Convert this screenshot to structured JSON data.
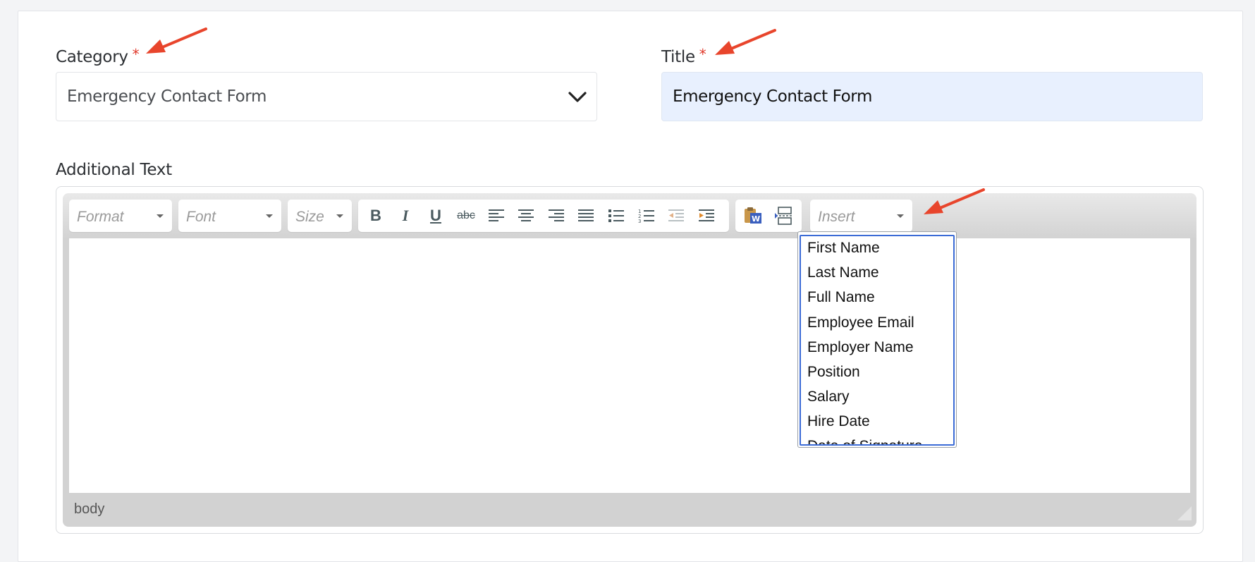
{
  "category": {
    "label": "Category",
    "required_mark": "*",
    "selected_value": "Emergency Contact Form"
  },
  "title": {
    "label": "Title",
    "required_mark": "*",
    "value": "Emergency Contact Form"
  },
  "additional_text": {
    "label": "Additional Text",
    "toolbar": {
      "format_placeholder": "Format",
      "font_placeholder": "Font",
      "size_placeholder": "Size",
      "insert_placeholder": "Insert",
      "buttons": [
        {
          "icon": "bold-icon",
          "glyph": "B"
        },
        {
          "icon": "italic-icon",
          "glyph": "I"
        },
        {
          "icon": "underline-icon",
          "glyph": "U"
        },
        {
          "icon": "strikethrough-icon",
          "glyph": "abc"
        },
        {
          "icon": "align-left-icon"
        },
        {
          "icon": "align-center-icon"
        },
        {
          "icon": "align-right-icon"
        },
        {
          "icon": "align-justify-icon"
        },
        {
          "icon": "bulleted-list-icon"
        },
        {
          "icon": "numbered-list-icon"
        },
        {
          "icon": "outdent-icon"
        },
        {
          "icon": "indent-icon"
        },
        {
          "icon": "paste-from-word-icon"
        },
        {
          "icon": "page-break-icon"
        }
      ]
    },
    "insert_options": [
      "First Name",
      "Last Name",
      "Full Name",
      "Employee Email",
      "Employer Name",
      "Position",
      "Salary",
      "Hire Date",
      "Date of Signature"
    ],
    "status_path": "body"
  },
  "colors": {
    "required": "#e0392b",
    "annotation_arrow": "#e8452c",
    "title_fill": "#e8f0fe",
    "dropdown_focus": "#3b6bd6"
  }
}
